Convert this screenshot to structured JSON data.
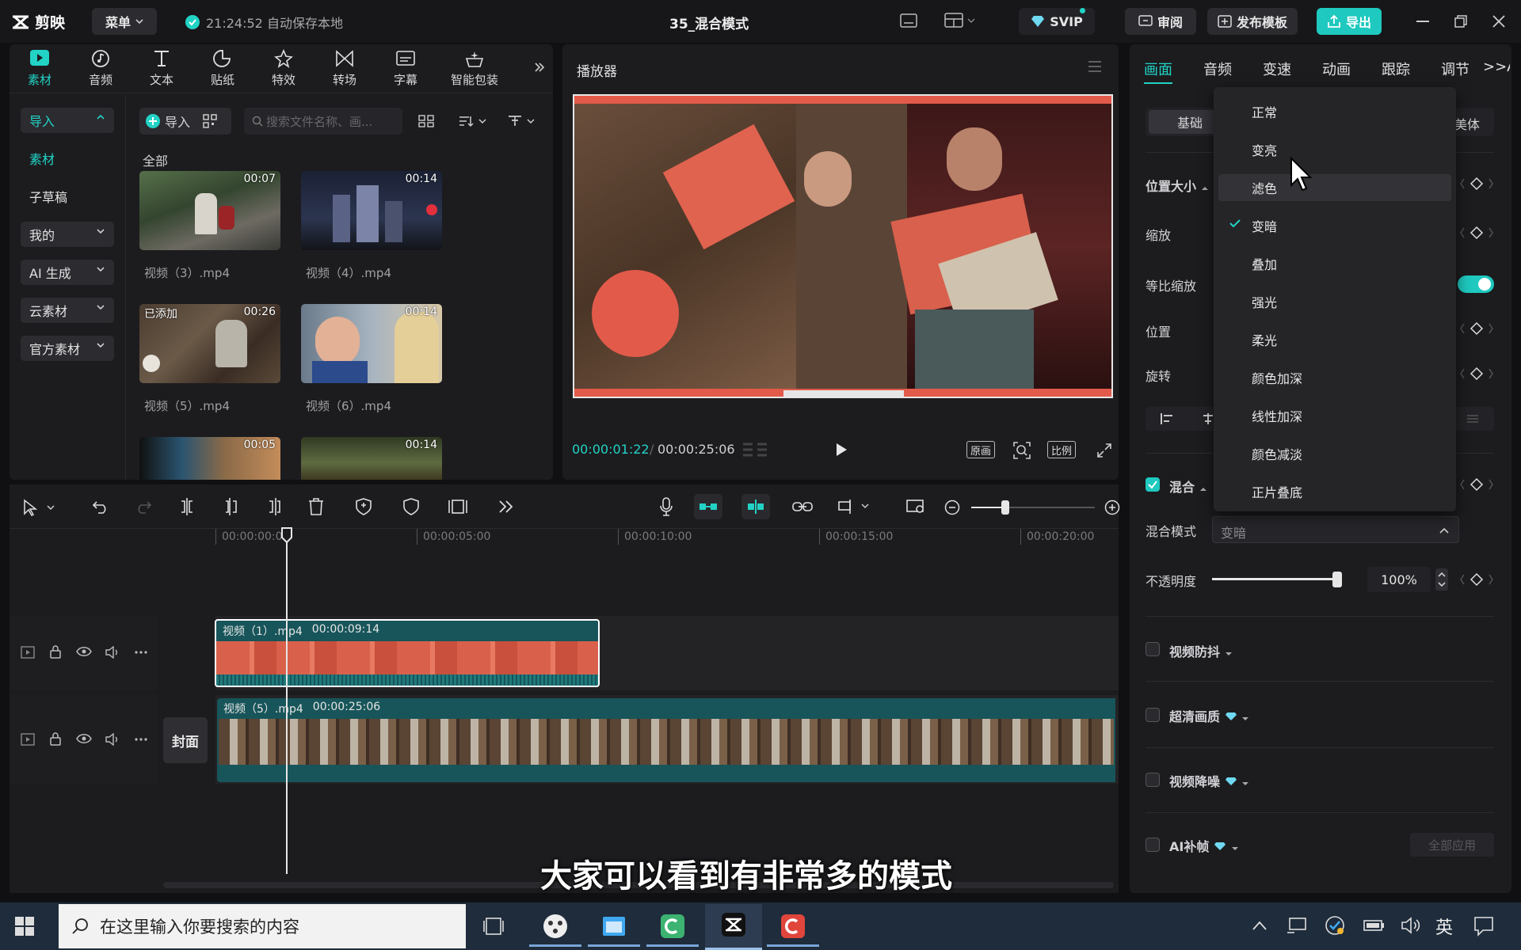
{
  "titlebar": {
    "logo": "剪映",
    "menu_label": "菜单",
    "autosave": "21:24:52 自动保存本地",
    "project_title": "35_混合模式",
    "svip": "SVIP",
    "review": "审阅",
    "publish": "发布模板",
    "export": "导出"
  },
  "media_tabs": [
    {
      "label": "素材",
      "icon": "media-icon"
    },
    {
      "label": "音频",
      "icon": "audio-icon"
    },
    {
      "label": "文本",
      "icon": "text-icon"
    },
    {
      "label": "贴纸",
      "icon": "sticker-icon"
    },
    {
      "label": "特效",
      "icon": "effects-icon"
    },
    {
      "label": "转场",
      "icon": "transition-icon"
    },
    {
      "label": "字幕",
      "icon": "subtitle-icon"
    },
    {
      "label": "智能包装",
      "icon": "smart-pack-icon"
    }
  ],
  "sidebar": {
    "import": "导入",
    "items": [
      "素材",
      "子草稿",
      "我的",
      "AI 生成",
      "云素材",
      "官方素材"
    ]
  },
  "media": {
    "import_btn": "导入",
    "search_placeholder": "搜索文件名称、画...",
    "section": "全部",
    "added_badge": "已添加",
    "files": [
      {
        "name": "视频（3）.mp4",
        "duration": "00:07"
      },
      {
        "name": "视频（4）.mp4",
        "duration": "00:14"
      },
      {
        "name": "视频（5）.mp4",
        "duration": "00:26"
      },
      {
        "name": "视频（6）.mp4",
        "duration": "00:14"
      },
      {
        "name": "",
        "duration": "00:05"
      },
      {
        "name": "",
        "duration": "00:14"
      }
    ]
  },
  "player": {
    "title": "播放器",
    "current_time": "00:00:01:22",
    "total_time": "00:00:25:06",
    "btn_original": "原画",
    "btn_ratio": "比例"
  },
  "timeline": {
    "ruler": [
      "00:00:00:00",
      "00:00:05:00",
      "00:00:10:00",
      "00:00:15:00",
      "00:00:20:00"
    ],
    "cover_label": "封面",
    "clip1": {
      "name": "视频（1）.mp4",
      "duration": "00:00:09:14"
    },
    "clip2": {
      "name": "视频（5）.mp4",
      "duration": "00:00:25:06"
    }
  },
  "right_panel": {
    "tabs": [
      "画面",
      "音频",
      "变速",
      "动画",
      "跟踪",
      "调节",
      ">>A"
    ],
    "sub_basic": "基础",
    "sub_beauty": "美体",
    "position_size": "位置大小",
    "scale": "缩放",
    "uniform_scale": "等比缩放",
    "position": "位置",
    "rotation": "旋转",
    "blend": "混合",
    "blend_mode_label": "混合模式",
    "blend_mode_value": "变暗",
    "opacity_label": "不透明度",
    "opacity_value": "100%",
    "opacity_fraction": 1.0,
    "anti_shake": "视频防抖",
    "hd": "超清画质",
    "denoise": "视频降噪",
    "ai_frame": "AI补帧",
    "apply_all": "全部应用"
  },
  "blend_menu": {
    "selected": "变暗",
    "items": [
      "正常",
      "变亮",
      "滤色",
      "变暗",
      "叠加",
      "强光",
      "柔光",
      "颜色加深",
      "线性加深",
      "颜色减淡",
      "正片叠底"
    ]
  },
  "subtitle": "大家可以看到有非常多的模式",
  "taskbar": {
    "search_placeholder": "在这里输入你要搜索的内容",
    "ime": "英"
  },
  "colors": {
    "accent": "#22d3c5",
    "clip_teal": "#17555a",
    "export_btn": "#1fc9bf"
  }
}
